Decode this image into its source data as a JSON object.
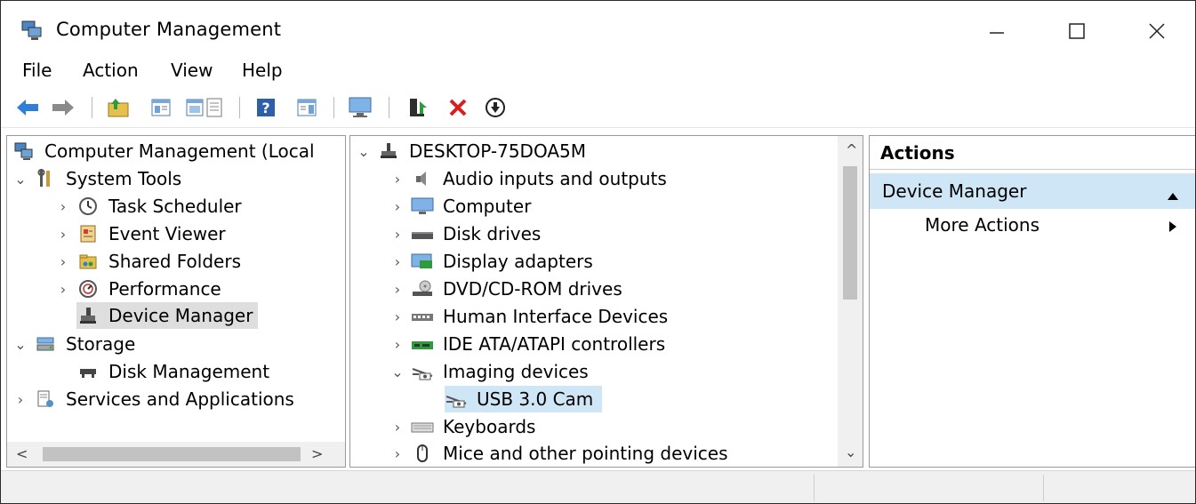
{
  "window": {
    "title": "Computer Management"
  },
  "menu": [
    "File",
    "Action",
    "View",
    "Help"
  ],
  "tree": {
    "root": "Computer Management (Local",
    "system_tools": "System Tools",
    "task_scheduler": "Task Scheduler",
    "event_viewer": "Event Viewer",
    "shared_folders": "Shared Folders",
    "performance": "Performance",
    "device_manager": "Device Manager",
    "storage": "Storage",
    "disk_management": "Disk Management",
    "services_apps": "Services and Applications"
  },
  "devices": {
    "computer_name": "DESKTOP-75DOA5M",
    "items": [
      "Audio inputs and outputs",
      "Computer",
      "Disk drives",
      "Display adapters",
      "DVD/CD-ROM drives",
      "Human Interface Devices",
      "IDE ATA/ATAPI controllers",
      "Imaging devices",
      "Keyboards",
      "Mice and other pointing devices"
    ],
    "child": "USB 3.0 Cam"
  },
  "actions": {
    "title": "Actions",
    "section": "Device Manager",
    "more": "More Actions"
  },
  "colors": {
    "selection_blue": "#cfe6f7",
    "selection_gray": "#dedede",
    "delete_red": "#d42020"
  }
}
